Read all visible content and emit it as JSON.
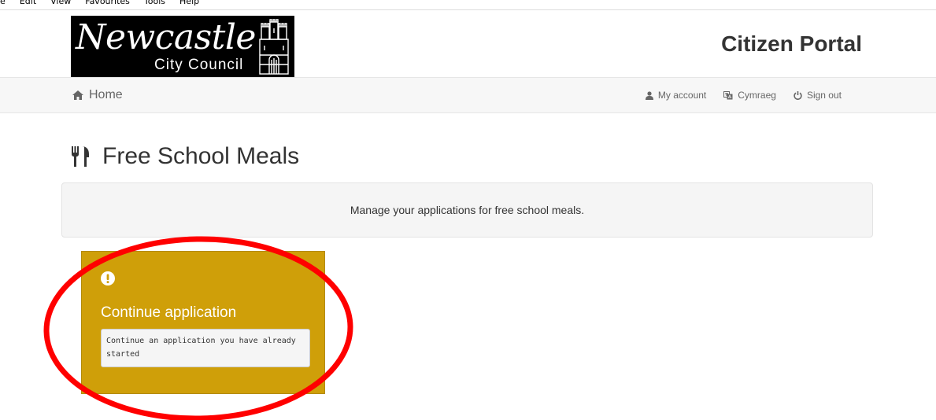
{
  "browser_menu": {
    "items": [
      "le",
      "Edit",
      "View",
      "Favourites",
      "Tools",
      "Help"
    ]
  },
  "header": {
    "logo_main": "Newcastle",
    "logo_sub": "City Council",
    "portal_title": "Citizen Portal"
  },
  "navbar": {
    "home_label": "Home",
    "my_account_label": "My account",
    "language_label": "Cymraeg",
    "sign_out_label": "Sign out"
  },
  "page": {
    "title": "Free School Meals",
    "info_text": "Manage your applications for free school meals."
  },
  "card": {
    "title": "Continue application",
    "description": "Continue an application you have already started",
    "background_color": "#cf9f09"
  },
  "annotation": {
    "color": "#ff0000"
  }
}
